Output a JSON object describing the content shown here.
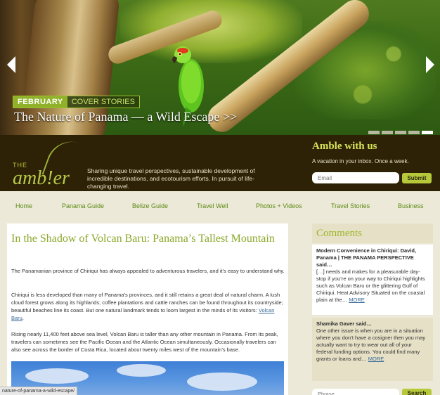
{
  "hero": {
    "month": "FEBRUARY",
    "label": "COVER STORIES",
    "title": "The Nature of Panama — a Wild Escape  >>",
    "slides": 5,
    "active_slide": 5
  },
  "header": {
    "logo_the": "THE",
    "logo_name": "amb!er",
    "tagline": "Sharing unique travel perspectives, sustainable development of incredible destinations, and ecotourism efforts. In pursuit of life-changing travel.",
    "newsletter_title": "Amble with us",
    "newsletter_sub": "A vacation in your inbox. Once a week.",
    "email_placeholder": "Email",
    "submit_label": "Submit"
  },
  "nav": [
    "Home",
    "Panama Guide",
    "Belize Guide",
    "Travel Well",
    "Photos + Videos",
    "Travel Stories",
    "Business"
  ],
  "article": {
    "title": "In the Shadow of Volcan Baru: Panama’s Tallest Mountain",
    "p1": "The Panamanian province of Chiriqui has always appealed to adventurous travelers, and it’s easy to understand why.",
    "p2_before": "Chiriqui is less developed than many of Panama’s provinces, and it still retains a great deal of natural charm. A lush cloud forest grows along its highlands; coffee plantations and cattle ranches can be found throughout its countryside; beautiful beaches line its coast. But one natural landmark tends to loom largest in the minds of its visitors: ",
    "p2_link": "Volcan Baru",
    "p2_after": ".",
    "p3": "Rising nearly 11,400 feet above sea level, Volcan Baru is taller than any other mountain in Panama. From its peak, travelers can sometimes see the Pacific Ocean and the Atlantic Ocean simultaneously. Occasionally travelers can also see across the border of Costa Rica, located about twenty miles west of the mountain’s base."
  },
  "status_url": "nature-of-panama-a-wild-escape/",
  "sidebar": {
    "heading": "Comments",
    "comments": [
      {
        "author": "Modern Convenience in Chiriqui: David, Panama | THE PANAMA PERSPECTIVE said…",
        "text": "[…] needs and makes for a pleasurable day-stop if you’re on your way to Chiriqui highlights such as Volcan Baru or the glittering Gulf of Chiriqui. Heat Advisory Situated on the coastal plain at the… ",
        "more": "MORE"
      },
      {
        "author": "Shamika Gaver said…",
        "text": "One other issue is when you are in a situation where you don’t have a cosigner then you may actually want to try to wear out all of your federal funding options. You could find many grants or loans and… ",
        "more": "MORE"
      }
    ],
    "search_placeholder": "Phrase",
    "search_label": "Search"
  },
  "colors": {
    "accent_green": "#8fb22a",
    "band_brown": "#2e2206",
    "page_bg": "#ede9d8",
    "link_blue": "#3a6a99"
  },
  "icons": [
    "left-arrow-icon",
    "right-arrow-icon",
    "logo-swoosh-icon"
  ]
}
